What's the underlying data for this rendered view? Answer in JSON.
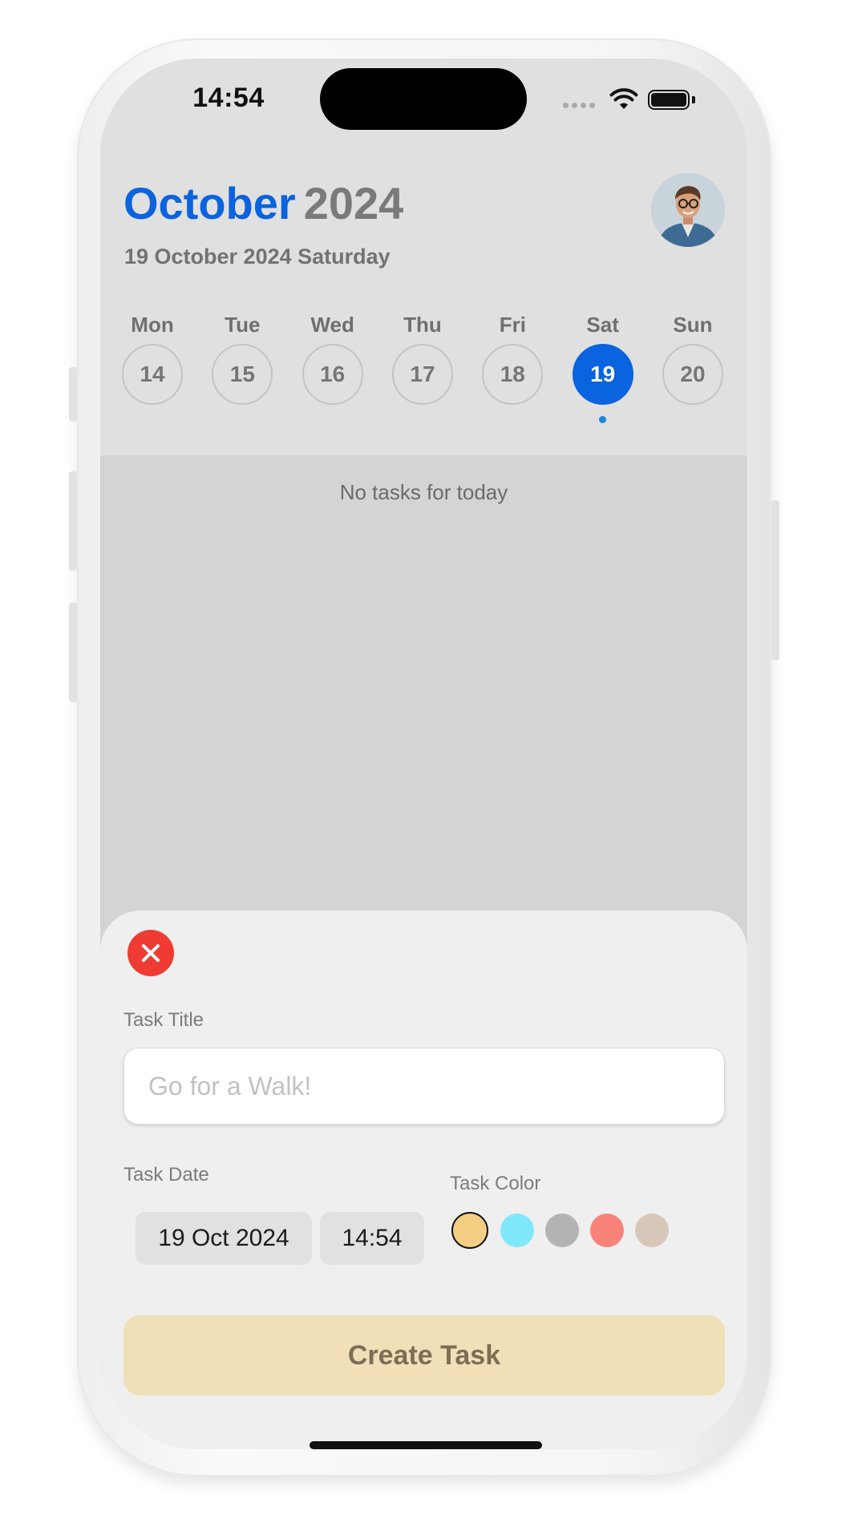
{
  "status_bar": {
    "time": "14:54"
  },
  "header": {
    "month": "October",
    "year": "2024",
    "subtitle": "19 October 2024 Saturday"
  },
  "week": [
    {
      "name": "Mon",
      "num": "14",
      "selected": false
    },
    {
      "name": "Tue",
      "num": "15",
      "selected": false
    },
    {
      "name": "Wed",
      "num": "16",
      "selected": false
    },
    {
      "name": "Thu",
      "num": "17",
      "selected": false
    },
    {
      "name": "Fri",
      "num": "18",
      "selected": false
    },
    {
      "name": "Sat",
      "num": "19",
      "selected": true
    },
    {
      "name": "Sun",
      "num": "20",
      "selected": false
    }
  ],
  "tasks": {
    "empty_message": "No tasks for today"
  },
  "sheet": {
    "title_label": "Task Title",
    "title_placeholder": "Go for a Walk!",
    "date_label": "Task Date",
    "date_value": "19 Oct 2024",
    "time_value": "14:54",
    "color_label": "Task Color",
    "colors": [
      "#f4cf83",
      "#7fe8fb",
      "#b3b3b3",
      "#f9837a",
      "#d7c7b9"
    ],
    "selected_color": 0,
    "create_label": "Create Task"
  },
  "theme": {
    "accent": "#0a63df",
    "close": "#ef3b34",
    "create_bg": "#f1dfb8"
  }
}
